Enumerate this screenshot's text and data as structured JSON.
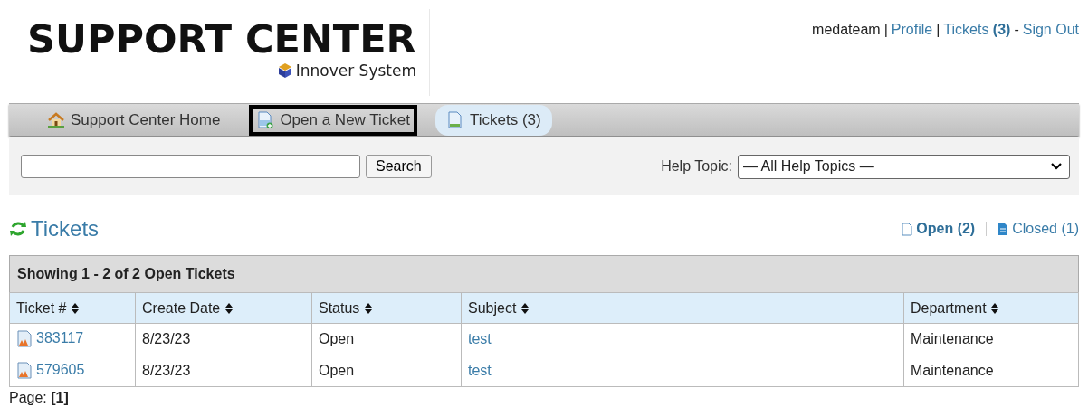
{
  "logo": {
    "title": "SUPPORT CENTER",
    "subtitle": "Innover System"
  },
  "user_bar": [
    {
      "kind": "text",
      "text": "medateam"
    },
    {
      "kind": "sep",
      "text": "|"
    },
    {
      "kind": "link",
      "text": "Profile"
    },
    {
      "kind": "sep",
      "text": "|"
    },
    {
      "kind": "link",
      "text": "Tickets **(3)**"
    },
    {
      "kind": "sep",
      "text": "-"
    },
    {
      "kind": "link",
      "text": "Sign Out"
    }
  ],
  "nav": [
    {
      "label": "Support Center Home",
      "selected": false,
      "outlined": false
    },
    {
      "label": "Open a New Ticket",
      "selected": false,
      "outlined": true
    },
    {
      "label": "Tickets (3)",
      "selected": true,
      "outlined": false
    }
  ],
  "search": {
    "button": "Search",
    "help_label": "Help Topic:",
    "help_value": "— All Help Topics —"
  },
  "heading": "Tickets",
  "filters": [
    {
      "label": "Open (2)",
      "selected": true
    },
    {
      "label": "Closed (1)",
      "selected": false
    }
  ],
  "table": {
    "caption": "Showing 1 - 2 of 2 Open Tickets",
    "columns": [
      "Ticket #",
      "Create Date",
      "Status",
      "Subject",
      "Department"
    ],
    "rows": [
      [
        "383117",
        "8/23/23",
        "Open",
        "test",
        "Maintenance"
      ],
      [
        "579605",
        "8/23/23",
        "Open",
        "test",
        "Maintenance"
      ]
    ]
  },
  "pager": {
    "label": "Page:",
    "current": "[1]"
  }
}
